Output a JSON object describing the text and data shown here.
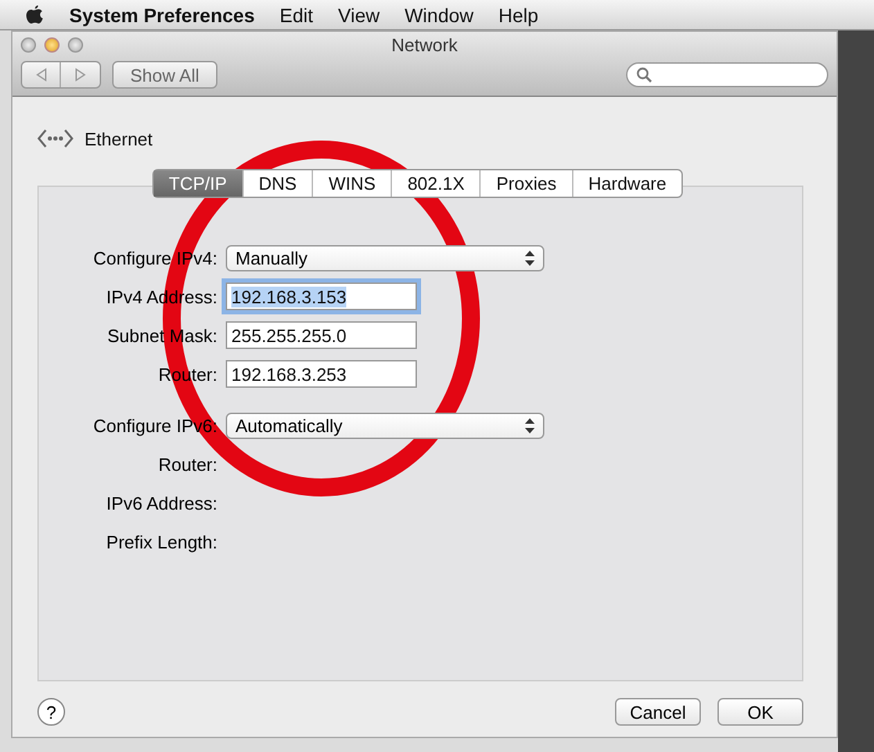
{
  "menu_bar": {
    "app": "System Preferences",
    "items": [
      "Edit",
      "View",
      "Window",
      "Help"
    ]
  },
  "window": {
    "title": "Network",
    "toolbar": {
      "show_all": "Show All"
    }
  },
  "service": {
    "name": "Ethernet"
  },
  "tabs": [
    {
      "label": "TCP/IP",
      "selected": true
    },
    {
      "label": "DNS",
      "selected": false
    },
    {
      "label": "WINS",
      "selected": false
    },
    {
      "label": "802.1X",
      "selected": false
    },
    {
      "label": "Proxies",
      "selected": false
    },
    {
      "label": "Hardware",
      "selected": false
    }
  ],
  "rows": [
    {
      "kind": "popup",
      "label": "Configure IPv4:",
      "value": "Manually"
    },
    {
      "kind": "field",
      "label": "IPv4 Address:",
      "value": "192.168.3.153",
      "selected": true
    },
    {
      "kind": "field",
      "label": "Subnet Mask:",
      "value": "255.255.255.0",
      "selected": false
    },
    {
      "kind": "field",
      "label": "Router:",
      "value": "192.168.3.253",
      "selected": false
    },
    {
      "kind": "popup",
      "label": "Configure IPv6:",
      "value": "Automatically"
    },
    {
      "kind": "label",
      "label": "Router:"
    },
    {
      "kind": "label",
      "label": "IPv6 Address:"
    },
    {
      "kind": "label",
      "label": "Prefix Length:"
    }
  ],
  "help": "?",
  "buttons": [
    "Cancel",
    "OK"
  ]
}
